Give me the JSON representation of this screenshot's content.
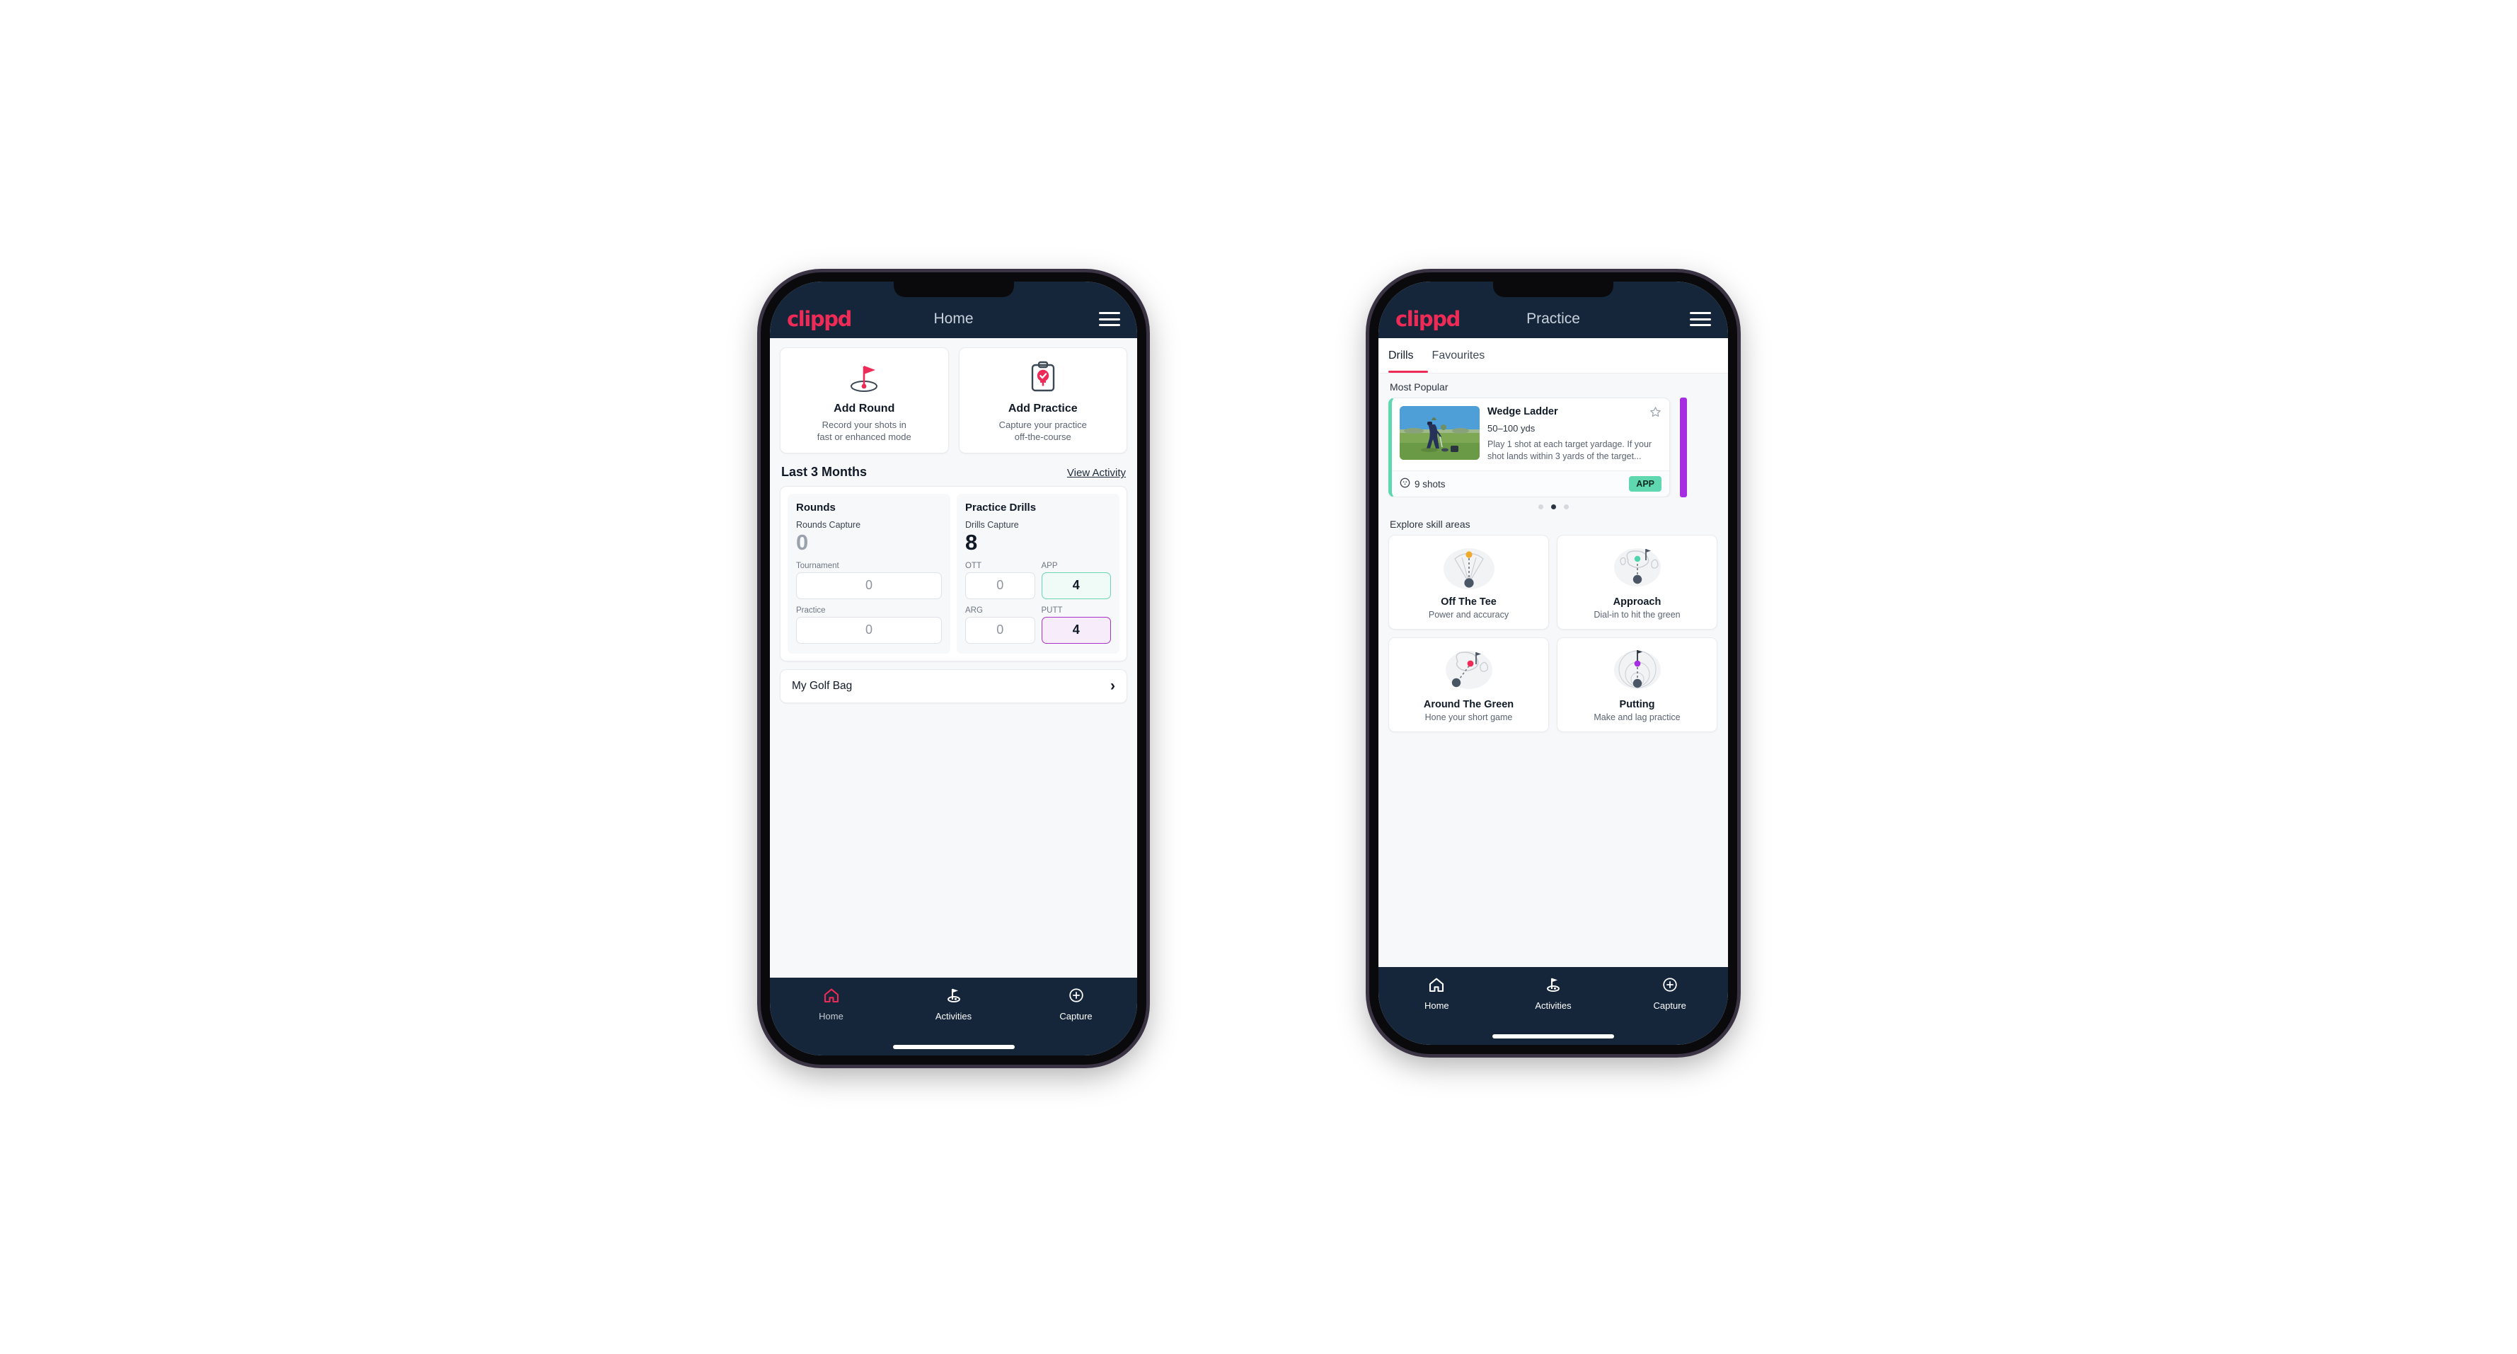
{
  "colors": {
    "header_navy": "#15263a",
    "brand_pink": "#ee2a56",
    "page_bg": "#f7f8fa",
    "teal": "#5fd8b0",
    "purple": "#a933c9",
    "canvas": "#ffffff"
  },
  "phone_home": {
    "appbar": {
      "logo": "clippd",
      "title": "Home",
      "menu_icon": "hamburger-menu-icon"
    },
    "actions": [
      {
        "icon": "golf-flag-hole-icon",
        "title": "Add Round",
        "subtitle_line1": "Record your shots in",
        "subtitle_line2": "fast or enhanced mode"
      },
      {
        "icon": "clipboard-check-tee-icon",
        "title": "Add Practice",
        "subtitle_line1": "Capture your practice",
        "subtitle_line2": "off-the-course"
      }
    ],
    "section": {
      "title": "Last 3 Months",
      "link": "View Activity"
    },
    "stats": {
      "rounds": {
        "heading": "Rounds",
        "capture_label": "Rounds Capture",
        "capture_value": "0",
        "fields": [
          {
            "label": "Tournament",
            "value": "0",
            "style": "plain"
          },
          {
            "label": "Practice",
            "value": "0",
            "style": "plain"
          }
        ]
      },
      "drills": {
        "heading": "Practice Drills",
        "capture_label": "Drills Capture",
        "capture_value": "8",
        "fields": [
          {
            "label": "OTT",
            "value": "0",
            "style": "plain"
          },
          {
            "label": "APP",
            "value": "4",
            "style": "app"
          },
          {
            "label": "ARG",
            "value": "0",
            "style": "plain"
          },
          {
            "label": "PUTT",
            "value": "4",
            "style": "putt"
          }
        ]
      }
    },
    "golf_bag": {
      "label": "My Golf Bag",
      "chevron": "chevron-right-icon"
    },
    "bottom_nav": [
      {
        "label": "Home",
        "icon": "home-icon",
        "active": true
      },
      {
        "label": "Activities",
        "icon": "golf-flag-icon",
        "active": false
      },
      {
        "label": "Capture",
        "icon": "plus-circle-icon",
        "active": false
      }
    ]
  },
  "phone_practice": {
    "appbar": {
      "logo": "clippd",
      "title": "Practice",
      "menu_icon": "hamburger-menu-icon"
    },
    "tabs": [
      {
        "label": "Drills",
        "active": true
      },
      {
        "label": "Favourites",
        "active": false
      }
    ],
    "most_popular_label": "Most Popular",
    "drill": {
      "title": "Wedge Ladder",
      "yardage": "50–100 yds",
      "description": "Play 1 shot at each target yardage. If your shot lands within 3 yards of the target...",
      "shots": "9 shots",
      "shots_icon": "golf-ball-icon",
      "badge": "APP",
      "favourite_icon": "star-outline-icon",
      "thumbnail": "golfer-chipping-photo",
      "accent_color": "#5fd8b0",
      "next_accent_color": "#a52ee0"
    },
    "carousel_dots": {
      "count": 3,
      "active_index": 1
    },
    "explore_label": "Explore skill areas",
    "skills": [
      {
        "icon": "tee-shot-dispersion-icon",
        "title": "Off The Tee",
        "subtitle": "Power and accuracy",
        "dot_color": "#f0a92c"
      },
      {
        "icon": "green-approach-icon",
        "title": "Approach",
        "subtitle": "Dial-in to hit the green",
        "dot_color": "#4fd4ae"
      },
      {
        "icon": "chip-around-green-icon",
        "title": "Around The Green",
        "subtitle": "Hone your short game",
        "dot_color": "#ee2a56"
      },
      {
        "icon": "putting-rings-icon",
        "title": "Putting",
        "subtitle": "Make and lag practice",
        "dot_color": "#a52ee0"
      }
    ],
    "bottom_nav": [
      {
        "label": "Home",
        "icon": "home-icon",
        "active": false
      },
      {
        "label": "Activities",
        "icon": "golf-flag-icon",
        "active": true
      },
      {
        "label": "Capture",
        "icon": "plus-circle-icon",
        "active": false
      }
    ]
  }
}
